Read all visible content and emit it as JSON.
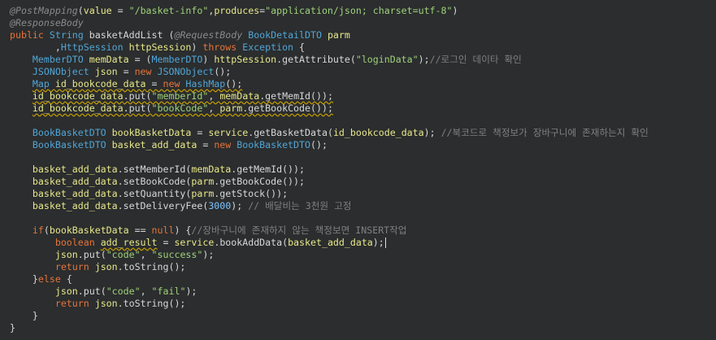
{
  "editor": {
    "lines": [
      [
        [
          "ann",
          "@PostMapping"
        ],
        [
          "plain",
          "("
        ],
        [
          "var",
          "value"
        ],
        [
          "plain",
          " = "
        ],
        [
          "str",
          "\"/basket-info\""
        ],
        [
          "plain",
          ","
        ],
        [
          "var",
          "produces"
        ],
        [
          "plain",
          "="
        ],
        [
          "str",
          "\"application/json; charset=utf-8\""
        ],
        [
          "plain",
          ")"
        ]
      ],
      [
        [
          "ann",
          "@ResponseBody"
        ]
      ],
      [
        [
          "kw",
          "public "
        ],
        [
          "ty",
          "String "
        ],
        [
          "mth",
          "basketAddList "
        ],
        [
          "plain",
          "("
        ],
        [
          "ann",
          "@RequestBody "
        ],
        [
          "ty",
          "BookDetailDTO "
        ],
        [
          "var",
          "parm"
        ]
      ],
      [
        [
          "plain",
          "        ,"
        ],
        [
          "ty",
          "HttpSession "
        ],
        [
          "var",
          "httpSession"
        ],
        [
          "plain",
          ") "
        ],
        [
          "kw",
          "throws "
        ],
        [
          "ty",
          "Exception "
        ],
        [
          "plain",
          "{"
        ]
      ],
      [
        [
          "plain",
          "    "
        ],
        [
          "ty",
          "MemberDTO "
        ],
        [
          "var",
          "memData"
        ],
        [
          "plain",
          " = ("
        ],
        [
          "ty",
          "MemberDTO"
        ],
        [
          "plain",
          ") "
        ],
        [
          "var",
          "httpSession"
        ],
        [
          "plain",
          "."
        ],
        [
          "mth",
          "getAttribute"
        ],
        [
          "plain",
          "("
        ],
        [
          "str",
          "\"loginData\""
        ],
        [
          "plain",
          ");"
        ],
        [
          "cm",
          "//로그인 데이타 확인"
        ]
      ],
      [
        [
          "plain",
          "    "
        ],
        [
          "ty",
          "JSONObject "
        ],
        [
          "var",
          "json"
        ],
        [
          "plain",
          " = "
        ],
        [
          "kw",
          "new "
        ],
        [
          "ty",
          "JSONObject"
        ],
        [
          "plain",
          "();"
        ]
      ],
      [
        [
          "plain",
          "    "
        ],
        [
          "ty",
          "Map "
        ],
        [
          "var",
          "id_bookcode_data"
        ],
        [
          "plain",
          " = "
        ],
        [
          "kw",
          "new "
        ],
        [
          "ty",
          "HashMap"
        ],
        [
          "plain",
          "();"
        ]
      ],
      [
        [
          "plain",
          "    "
        ],
        [
          "var",
          "id_bookcode_data"
        ],
        [
          "plain",
          "."
        ],
        [
          "mth",
          "put"
        ],
        [
          "plain",
          "("
        ],
        [
          "str",
          "\"memberId\""
        ],
        [
          "plain",
          ", "
        ],
        [
          "var",
          "memData"
        ],
        [
          "plain",
          "."
        ],
        [
          "mth",
          "getMemId"
        ],
        [
          "plain",
          "());"
        ]
      ],
      [
        [
          "plain",
          "    "
        ],
        [
          "var",
          "id_bookcode_data"
        ],
        [
          "plain",
          "."
        ],
        [
          "mth",
          "put"
        ],
        [
          "plain",
          "("
        ],
        [
          "str",
          "\"bookCode\""
        ],
        [
          "plain",
          ", "
        ],
        [
          "var",
          "parm"
        ],
        [
          "plain",
          "."
        ],
        [
          "mth",
          "getBookCode"
        ],
        [
          "plain",
          "());"
        ]
      ],
      [],
      [
        [
          "plain",
          "    "
        ],
        [
          "ty",
          "BookBasketDTO "
        ],
        [
          "var",
          "bookBasketData"
        ],
        [
          "plain",
          " = "
        ],
        [
          "var",
          "service"
        ],
        [
          "plain",
          "."
        ],
        [
          "mth",
          "getBasketData"
        ],
        [
          "plain",
          "("
        ],
        [
          "var",
          "id_bookcode_data"
        ],
        [
          "plain",
          "); "
        ],
        [
          "cm",
          "//북코드로 책정보가 장바구니에 존재하는지 확인"
        ]
      ],
      [
        [
          "plain",
          "    "
        ],
        [
          "ty",
          "BookBasketDTO "
        ],
        [
          "var",
          "basket_add_data"
        ],
        [
          "plain",
          " = "
        ],
        [
          "kw",
          "new "
        ],
        [
          "ty",
          "BookBasketDTO"
        ],
        [
          "plain",
          "();"
        ]
      ],
      [],
      [
        [
          "plain",
          "    "
        ],
        [
          "var",
          "basket_add_data"
        ],
        [
          "plain",
          "."
        ],
        [
          "mth",
          "setMemberId"
        ],
        [
          "plain",
          "("
        ],
        [
          "var",
          "memData"
        ],
        [
          "plain",
          "."
        ],
        [
          "mth",
          "getMemId"
        ],
        [
          "plain",
          "());"
        ]
      ],
      [
        [
          "plain",
          "    "
        ],
        [
          "var",
          "basket_add_data"
        ],
        [
          "plain",
          "."
        ],
        [
          "mth",
          "setBookCode"
        ],
        [
          "plain",
          "("
        ],
        [
          "var",
          "parm"
        ],
        [
          "plain",
          "."
        ],
        [
          "mth",
          "getBookCode"
        ],
        [
          "plain",
          "());"
        ]
      ],
      [
        [
          "plain",
          "    "
        ],
        [
          "var",
          "basket_add_data"
        ],
        [
          "plain",
          "."
        ],
        [
          "mth",
          "setQuantity"
        ],
        [
          "plain",
          "("
        ],
        [
          "var",
          "parm"
        ],
        [
          "plain",
          "."
        ],
        [
          "mth",
          "getStock"
        ],
        [
          "plain",
          "());"
        ]
      ],
      [
        [
          "plain",
          "    "
        ],
        [
          "var",
          "basket_add_data"
        ],
        [
          "plain",
          "."
        ],
        [
          "mth",
          "setDeliveryFee"
        ],
        [
          "plain",
          "("
        ],
        [
          "num",
          "3000"
        ],
        [
          "plain",
          "); "
        ],
        [
          "cm",
          "// 배달비는 3천원 고정"
        ]
      ],
      [],
      [
        [
          "plain",
          "    "
        ],
        [
          "kw",
          "if"
        ],
        [
          "plain",
          "("
        ],
        [
          "var",
          "bookBasketData"
        ],
        [
          "plain",
          " == "
        ],
        [
          "kw",
          "null"
        ],
        [
          "plain",
          ") {"
        ],
        [
          "cm",
          "//장바구니에 존재하지 않는 책정보면 INSERT작업"
        ]
      ],
      [
        [
          "plain",
          "        "
        ],
        [
          "kw",
          "boolean "
        ],
        [
          "var",
          "add_result"
        ],
        [
          "plain",
          " = "
        ],
        [
          "var",
          "service"
        ],
        [
          "plain",
          "."
        ],
        [
          "mth",
          "bookAddData"
        ],
        [
          "plain",
          "("
        ],
        [
          "var",
          "basket_add_data"
        ],
        [
          "plain",
          ");"
        ]
      ],
      [
        [
          "plain",
          "        "
        ],
        [
          "var",
          "json"
        ],
        [
          "plain",
          "."
        ],
        [
          "mth",
          "put"
        ],
        [
          "plain",
          "("
        ],
        [
          "str",
          "\"code\""
        ],
        [
          "plain",
          ", "
        ],
        [
          "str",
          "\"success\""
        ],
        [
          "plain",
          ");"
        ]
      ],
      [
        [
          "plain",
          "        "
        ],
        [
          "kw",
          "return "
        ],
        [
          "var",
          "json"
        ],
        [
          "plain",
          "."
        ],
        [
          "mth",
          "toString"
        ],
        [
          "plain",
          "();"
        ]
      ],
      [
        [
          "plain",
          "    }"
        ],
        [
          "kw",
          "else "
        ],
        [
          "plain",
          "{"
        ]
      ],
      [
        [
          "plain",
          "        "
        ],
        [
          "var",
          "json"
        ],
        [
          "plain",
          "."
        ],
        [
          "mth",
          "put"
        ],
        [
          "plain",
          "("
        ],
        [
          "str",
          "\"code\""
        ],
        [
          "plain",
          ", "
        ],
        [
          "str",
          "\"fail\""
        ],
        [
          "plain",
          ");"
        ]
      ],
      [
        [
          "plain",
          "        "
        ],
        [
          "kw",
          "return "
        ],
        [
          "var",
          "json"
        ],
        [
          "plain",
          "."
        ],
        [
          "mth",
          "toString"
        ],
        [
          "plain",
          "();"
        ]
      ],
      [
        [
          "plain",
          "    }"
        ]
      ],
      [
        [
          "plain",
          "}"
        ]
      ]
    ]
  }
}
